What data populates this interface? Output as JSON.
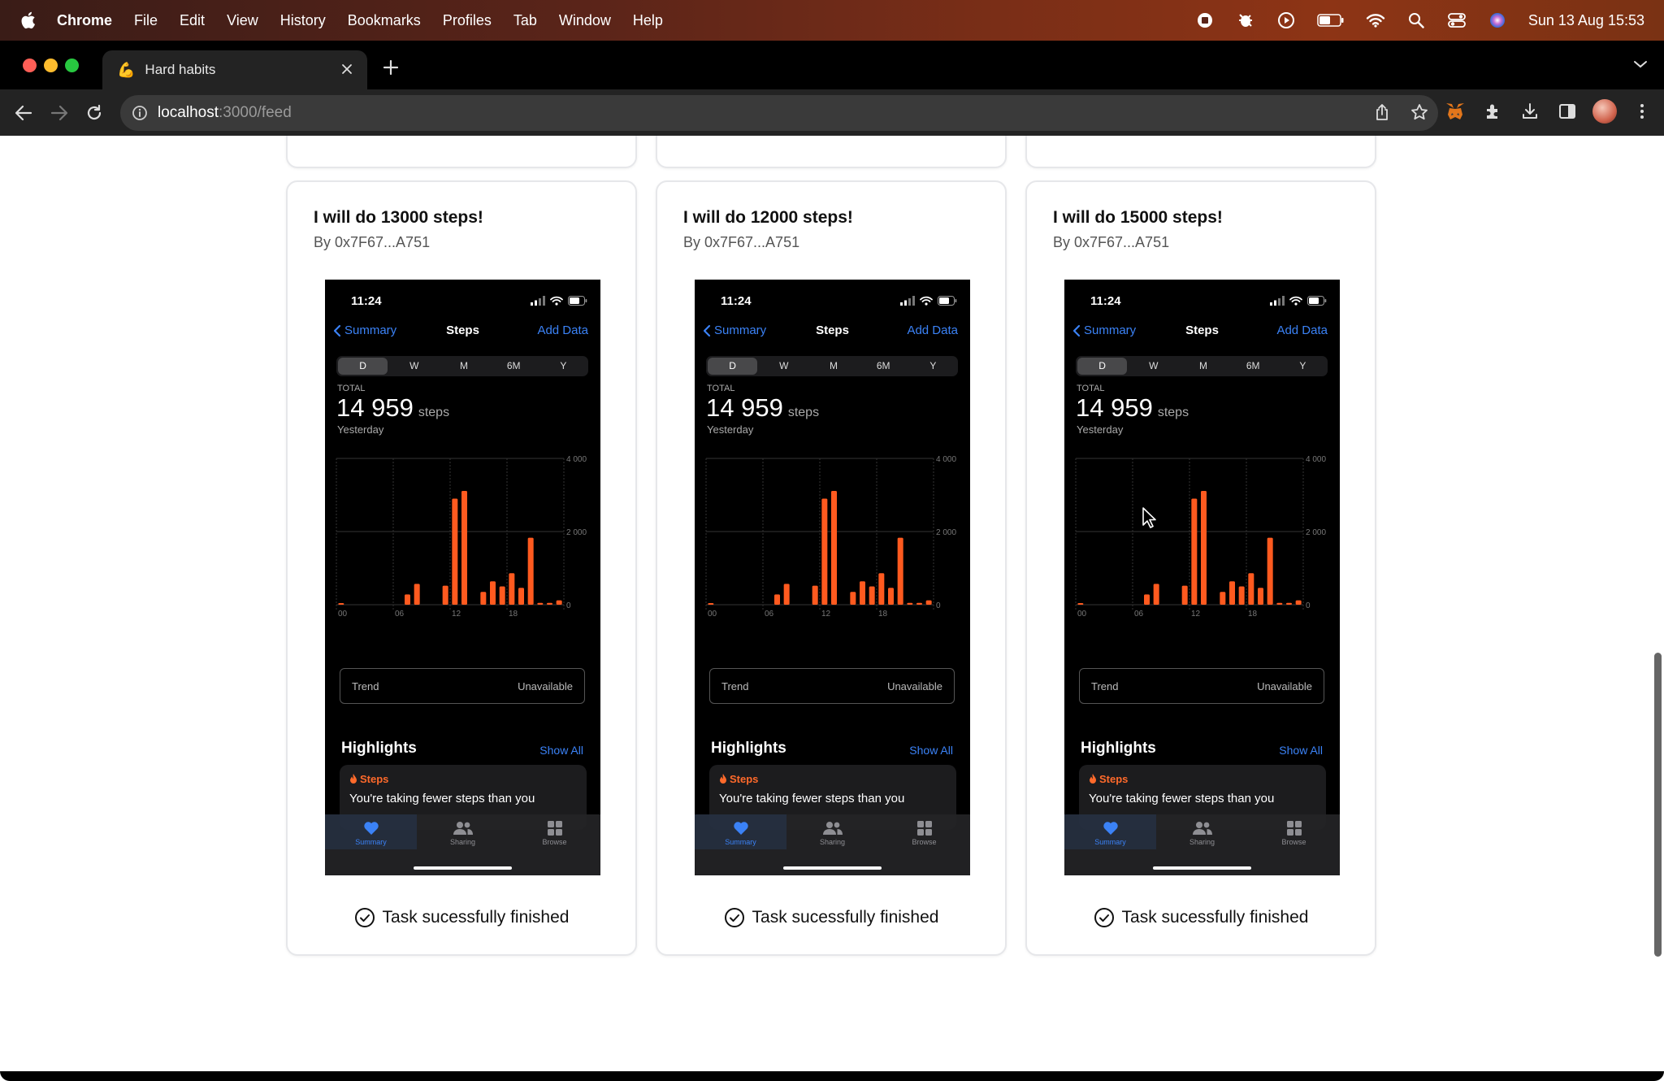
{
  "menubar": {
    "app": "Chrome",
    "items": [
      "File",
      "Edit",
      "View",
      "History",
      "Bookmarks",
      "Profiles",
      "Tab",
      "Window",
      "Help"
    ],
    "clock": "Sun 13 Aug  15:53"
  },
  "browser": {
    "tab_title": "Hard habits",
    "tab_favicon": "💪",
    "url_host": "localhost",
    "url_path": ":3000/feed"
  },
  "feed": {
    "cards": [
      {
        "title": "I will do 13000 steps!",
        "author": "By 0x7F67...A751",
        "status": "Task sucessfully finished"
      },
      {
        "title": "I will do 12000 steps!",
        "author": "By 0x7F67...A751",
        "status": "Task sucessfully finished"
      },
      {
        "title": "I will do 15000 steps!",
        "author": "By 0x7F67...A751",
        "status": "Task sucessfully finished"
      }
    ]
  },
  "screenshot": {
    "time": "11:24",
    "back": "Summary",
    "title": "Steps",
    "add": "Add Data",
    "segments": [
      "D",
      "W",
      "M",
      "6M",
      "Y"
    ],
    "total_label": "TOTAL",
    "total_value": "14 959",
    "total_unit": "steps",
    "period": "Yesterday",
    "trend_label": "Trend",
    "trend_value": "Unavailable",
    "highlights": "Highlights",
    "show_all": "Show All",
    "highlight_category": "Steps",
    "highlight_text": "You're taking fewer steps than you",
    "tabs": [
      "Summary",
      "Sharing",
      "Browse"
    ]
  },
  "chart_data": {
    "type": "bar",
    "categories": [
      "00",
      "01",
      "02",
      "03",
      "04",
      "05",
      "06",
      "07",
      "08",
      "09",
      "10",
      "11",
      "12",
      "13",
      "14",
      "15",
      "16",
      "17",
      "18",
      "19",
      "20",
      "21",
      "22",
      "23"
    ],
    "values": [
      30,
      0,
      0,
      0,
      0,
      0,
      0,
      280,
      570,
      0,
      0,
      520,
      2900,
      3110,
      0,
      350,
      640,
      500,
      860,
      460,
      1830,
      50,
      50,
      120
    ],
    "ylim": [
      0,
      4000
    ],
    "y_ticks": [
      "4 000",
      "2 000",
      "0"
    ],
    "x_ticks": [
      "00",
      "06",
      "12",
      "18"
    ],
    "color": "#ff5a1f"
  },
  "colors": {
    "accent_blue": "#3b82f6",
    "bar_orange": "#ff5a1f"
  }
}
